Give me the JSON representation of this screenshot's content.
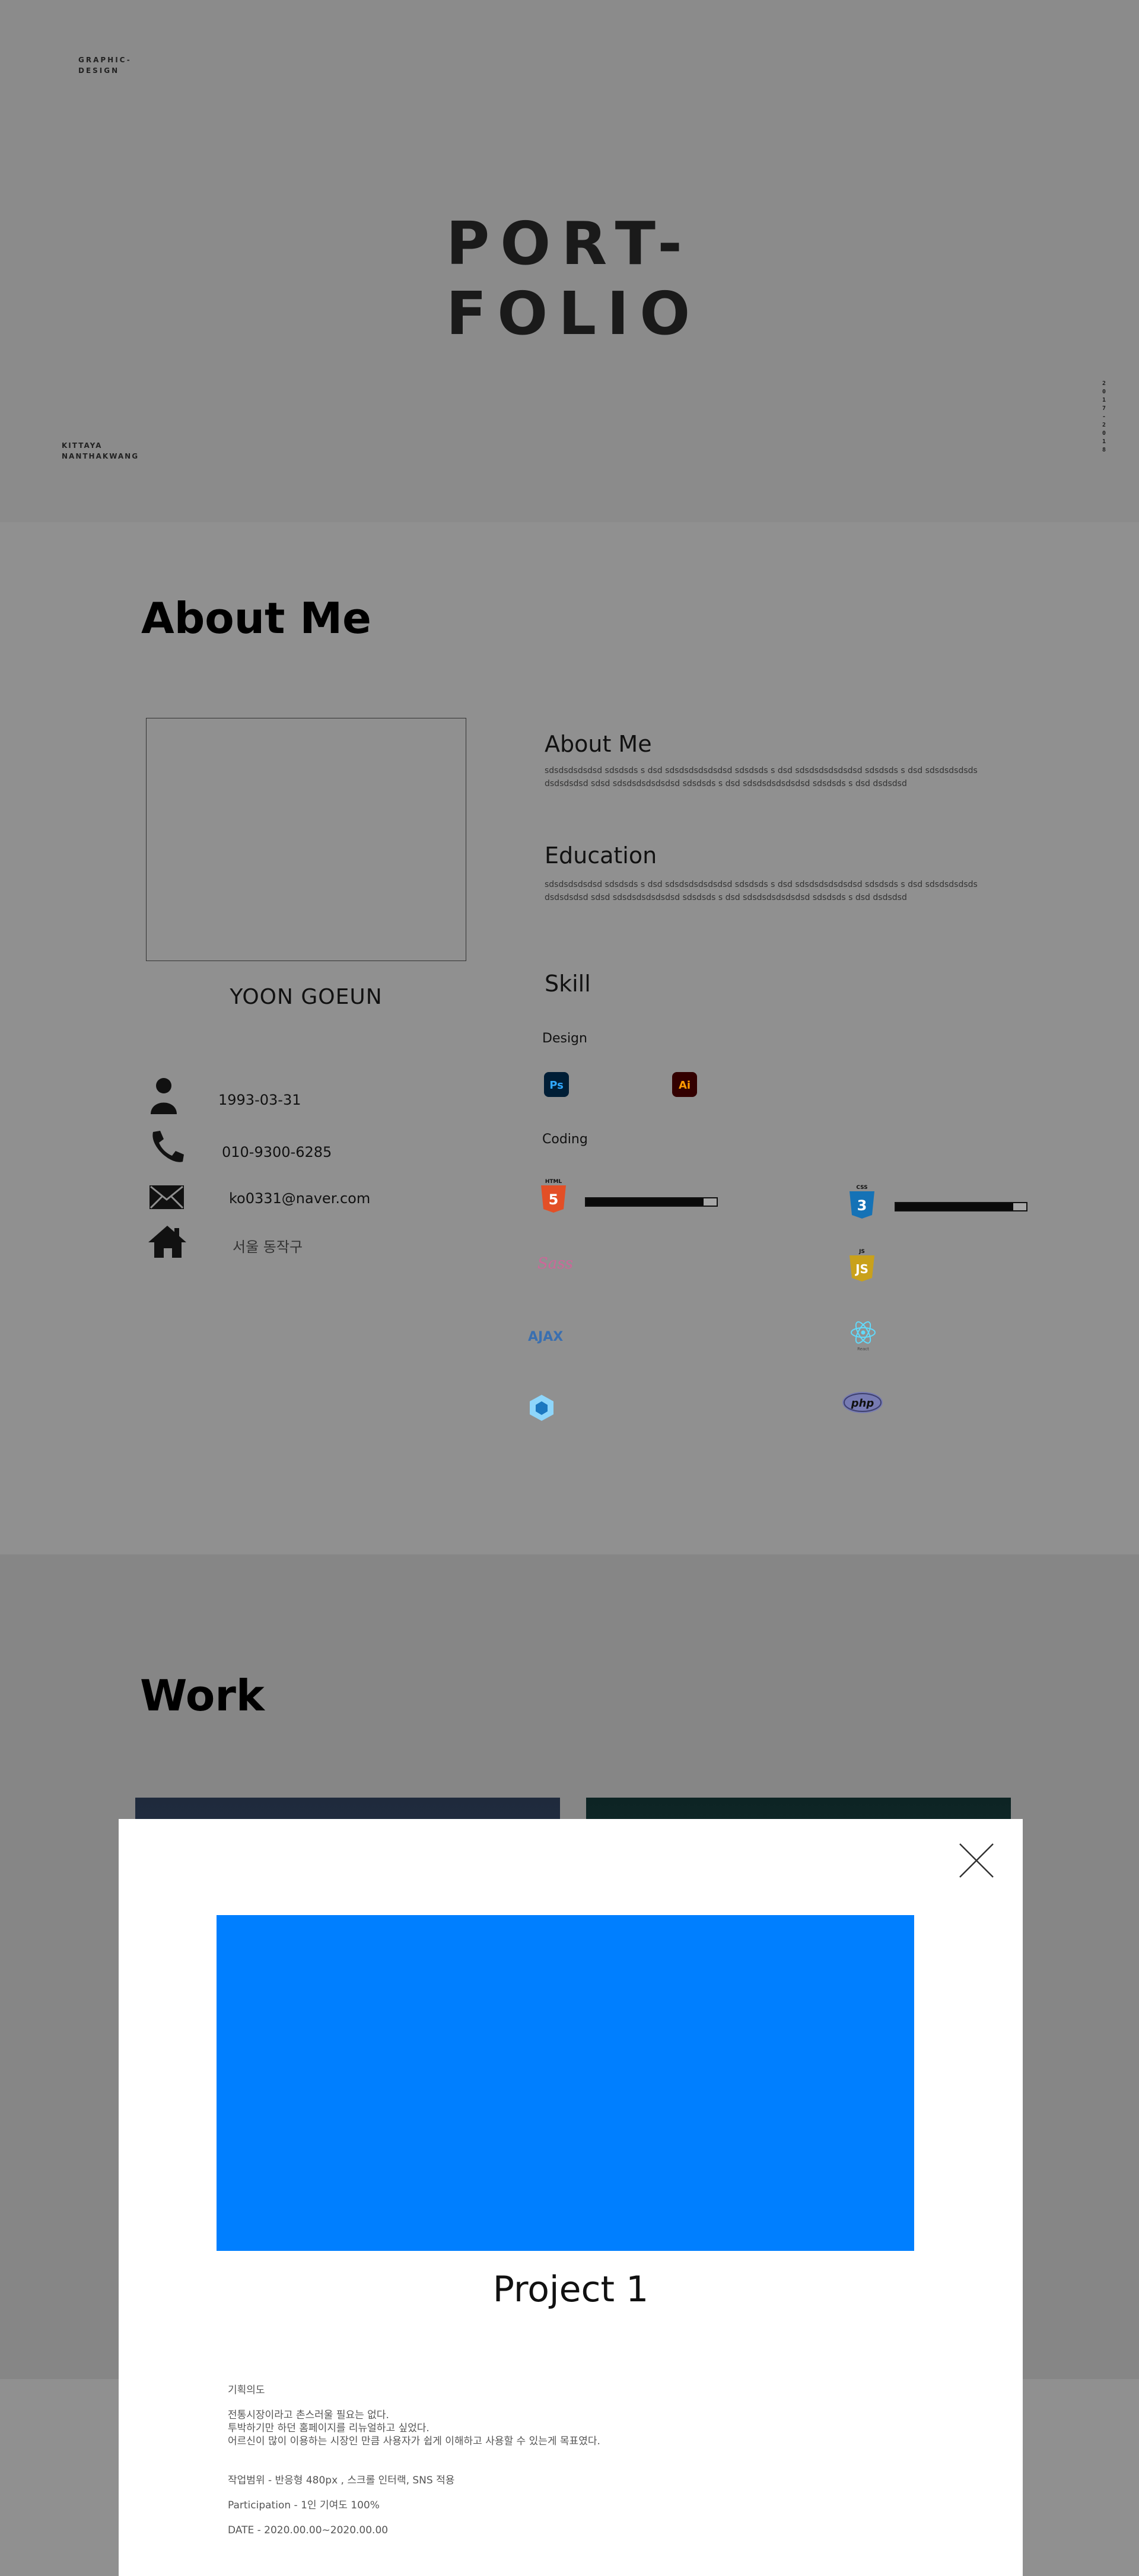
{
  "hero": {
    "tag": "GRAPHIC-\nDESIGN",
    "author": "KITTAYA\nNANTHAKWANG",
    "year": "2017-2018",
    "title": "PORT-\nFOLIO"
  },
  "about": {
    "section_title": "About Me",
    "name": "YOON GOEUN",
    "contacts": [
      {
        "icon": "person-icon",
        "text": "1993-03-31"
      },
      {
        "icon": "phone-icon",
        "text": "010-9300-6285"
      },
      {
        "icon": "mail-icon",
        "text": "ko0331@naver.com"
      },
      {
        "icon": "home-icon",
        "text": "서울 동작구"
      }
    ],
    "about_heading": "About Me",
    "about_text": "sdsdsdsdsdsd sdsdsds s dsd sdsdsdsdsdsdsd sdsdsds s dsd sdsdsdsdsdsdsd sdsdsds s dsd sdsdsdsdsds dsdsdsdsd  sdsd sdsdsdsdsdsdsd sdsdsds s dsd sdsdsdsdsdsdsd sdsdsds s dsd dsdsdsd",
    "education_heading": "Education",
    "education_text": "sdsdsdsdsdsd sdsdsds s dsd sdsdsdsdsdsdsd sdsdsds s dsd sdsdsdsdsdsdsd sdsdsds s dsd sdsdsdsdsds dsdsdsdsd  sdsd sdsdsdsdsdsdsd sdsdsds s dsd sdsdsdsdsdsdsd sdsdsds s dsd dsdsdsd",
    "skill_heading": "Skill",
    "design_label": "Design",
    "coding_label": "Coding",
    "design_skills": [
      {
        "icon": "photoshop-icon",
        "text": "Ps",
        "color": "#31a8ff",
        "bg": "#001e36"
      },
      {
        "icon": "illustrator-icon",
        "text": "Ai",
        "color": "#ff9a00",
        "bg": "#330000"
      }
    ],
    "coding_skills": [
      {
        "icon": "html5-icon",
        "label": "HTML",
        "level": 0.9
      },
      {
        "icon": "css3-icon",
        "label": "CSS",
        "level": 0.9
      }
    ],
    "other_icons": [
      "sass-icon",
      "js-icon",
      "ajax-icon",
      "react-icon",
      "webpack-icon",
      "php-icon"
    ],
    "sass_text": "Sass",
    "ajax_text": "AJAX",
    "js_text": "JS",
    "php_text": "php",
    "react_text": "React"
  },
  "work": {
    "section_title": "Work",
    "thumb1_color": "#1f2a3c",
    "thumb2_color": "#0d2424"
  },
  "modal": {
    "title": "Project 1",
    "image_color": "#007fff",
    "details_heading": "기획의도",
    "details_body": "전통시장이라고 촌스러울 필요는 없다.\n투박하기만 하던 홈페이지를 리뉴얼하고 싶었다.\n어르신이 많이 이용하는 시장인 만큼 사용자가 쉽게 이해하고 사용할 수 있는게 목표였다.",
    "scope": "작업범위 - 반응형 480px , 스크롤 인터랙, SNS 적용",
    "participation": "Participation - 1인 기여도 100%",
    "date": "DATE - 2020.00.00~2020.00.00"
  }
}
